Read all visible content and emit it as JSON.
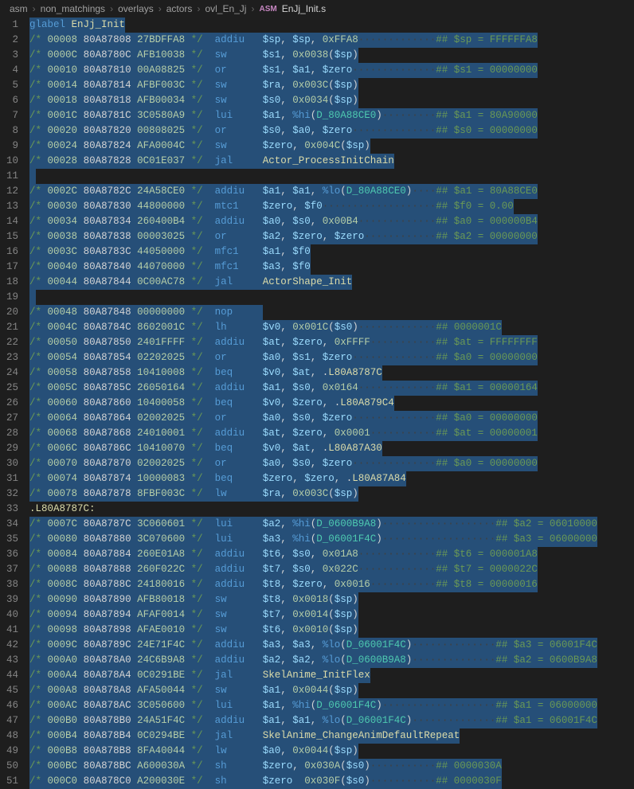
{
  "breadcrumb": {
    "parts": [
      "asm",
      "non_matchings",
      "overlays",
      "actors",
      "ovl_En_Jj"
    ],
    "file_icon_name": "asm-icon",
    "file_prefix": "ASM",
    "file": "EnJj_Init.s"
  },
  "glabel_kw": "glabel",
  "glabel_name": "EnJj_Init",
  "local_label": ".L80A8787C:",
  "lines": [
    {
      "n": 1,
      "type": "glabel"
    },
    {
      "n": 2,
      "c": "/* 00008 80A87808 27BDFFA8 */",
      "op": "addiu",
      "args": "$sp, $sp, 0xFFA8",
      "cm": "## $sp = FFFFFFA8"
    },
    {
      "n": 3,
      "c": "/* 0000C 80A8780C AFB10038 */",
      "op": "sw",
      "args": "$s1, 0x0038($sp)"
    },
    {
      "n": 4,
      "c": "/* 00010 80A87810 00A08825 */",
      "op": "or",
      "args": "$s1, $a1, $zero",
      "cm": "## $s1 = 00000000"
    },
    {
      "n": 5,
      "c": "/* 00014 80A87814 AFBF003C */",
      "op": "sw",
      "args": "$ra, 0x003C($sp)"
    },
    {
      "n": 6,
      "c": "/* 00018 80A87818 AFB00034 */",
      "op": "sw",
      "args": "$s0, 0x0034($sp)"
    },
    {
      "n": 7,
      "c": "/* 0001C 80A8781C 3C0580A9 */",
      "op": "lui",
      "args": "$a1, %hi(D_80A88CE0)",
      "cm": "## $a1 = 80A90000"
    },
    {
      "n": 8,
      "c": "/* 00020 80A87820 00808025 */",
      "op": "or",
      "args": "$s0, $a0, $zero",
      "cm": "## $s0 = 00000000"
    },
    {
      "n": 9,
      "c": "/* 00024 80A87824 AFA0004C */",
      "op": "sw",
      "args": "$zero, 0x004C($sp)"
    },
    {
      "n": 10,
      "c": "/* 00028 80A87828 0C01E037 */",
      "op": "jal",
      "args": "Actor_ProcessInitChain",
      "func": true
    },
    {
      "n": 11,
      "type": "blank"
    },
    {
      "n": 12,
      "c": "/* 0002C 80A8782C 24A58CE0 */",
      "op": "addiu",
      "args": "$a1, $a1, %lo(D_80A88CE0)",
      "cm": "## $a1 = 80A88CE0"
    },
    {
      "n": 13,
      "c": "/* 00030 80A87830 44800000 */",
      "op": "mtc1",
      "args": "$zero, $f0",
      "cm": "## $f0 = 0.00"
    },
    {
      "n": 14,
      "c": "/* 00034 80A87834 260400B4 */",
      "op": "addiu",
      "args": "$a0, $s0, 0x00B4",
      "cm": "## $a0 = 000000B4"
    },
    {
      "n": 15,
      "c": "/* 00038 80A87838 00003025 */",
      "op": "or",
      "args": "$a2, $zero, $zero",
      "cm": "## $a2 = 00000000"
    },
    {
      "n": 16,
      "c": "/* 0003C 80A8783C 44050000 */",
      "op": "mfc1",
      "args": "$a1, $f0"
    },
    {
      "n": 17,
      "c": "/* 00040 80A87840 44070000 */",
      "op": "mfc1",
      "args": "$a3, $f0"
    },
    {
      "n": 18,
      "c": "/* 00044 80A87844 0C00AC78 */",
      "op": "jal",
      "args": "ActorShape_Init",
      "func": true
    },
    {
      "n": 19,
      "type": "blank"
    },
    {
      "n": 20,
      "c": "/* 00048 80A87848 00000000 */",
      "op": "nop",
      "args": ""
    },
    {
      "n": 21,
      "c": "/* 0004C 80A8784C 8602001C */",
      "op": "lh",
      "args": "$v0, 0x001C($s0)",
      "cm": "## 0000001C"
    },
    {
      "n": 22,
      "c": "/* 00050 80A87850 2401FFFF */",
      "op": "addiu",
      "args": "$at, $zero, 0xFFFF",
      "cm": "## $at = FFFFFFFF"
    },
    {
      "n": 23,
      "c": "/* 00054 80A87854 02202025 */",
      "op": "or",
      "args": "$a0, $s1, $zero",
      "cm": "## $a0 = 00000000"
    },
    {
      "n": 24,
      "c": "/* 00058 80A87858 10410008 */",
      "op": "beq",
      "args": "$v0, $at, .L80A8787C"
    },
    {
      "n": 25,
      "c": "/* 0005C 80A8785C 26050164 */",
      "op": "addiu",
      "args": "$a1, $s0, 0x0164",
      "cm": "## $a1 = 00000164"
    },
    {
      "n": 26,
      "c": "/* 00060 80A87860 10400058 */",
      "op": "beq",
      "args": "$v0, $zero, .L80A879C4"
    },
    {
      "n": 27,
      "c": "/* 00064 80A87864 02002025 */",
      "op": "or",
      "args": "$a0, $s0, $zero",
      "cm": "## $a0 = 00000000"
    },
    {
      "n": 28,
      "c": "/* 00068 80A87868 24010001 */",
      "op": "addiu",
      "args": "$at, $zero, 0x0001",
      "cm": "## $at = 00000001"
    },
    {
      "n": 29,
      "c": "/* 0006C 80A8786C 10410070 */",
      "op": "beq",
      "args": "$v0, $at, .L80A87A30"
    },
    {
      "n": 30,
      "c": "/* 00070 80A87870 02002025 */",
      "op": "or",
      "args": "$a0, $s0, $zero",
      "cm": "## $a0 = 00000000"
    },
    {
      "n": 31,
      "c": "/* 00074 80A87874 10000083 */",
      "op": "beq",
      "args": "$zero, $zero, .L80A87A84"
    },
    {
      "n": 32,
      "c": "/* 00078 80A87878 8FBF003C */",
      "op": "lw",
      "args": "$ra, 0x003C($sp)"
    },
    {
      "n": 33,
      "type": "label"
    },
    {
      "n": 34,
      "c": "/* 0007C 80A8787C 3C060601 */",
      "op": "lui",
      "args": "$a2, %hi(D_0600B9A8)",
      "cm": "## $a2 = 06010000",
      "wide": true
    },
    {
      "n": 35,
      "c": "/* 00080 80A87880 3C070600 */",
      "op": "lui",
      "args": "$a3, %hi(D_06001F4C)",
      "cm": "## $a3 = 06000000",
      "wide": true
    },
    {
      "n": 36,
      "c": "/* 00084 80A87884 260E01A8 */",
      "op": "addiu",
      "args": "$t6, $s0, 0x01A8",
      "cm": "## $t6 = 000001A8"
    },
    {
      "n": 37,
      "c": "/* 00088 80A87888 260F022C */",
      "op": "addiu",
      "args": "$t7, $s0, 0x022C",
      "cm": "## $t7 = 0000022C"
    },
    {
      "n": 38,
      "c": "/* 0008C 80A8788C 24180016 */",
      "op": "addiu",
      "args": "$t8, $zero, 0x0016",
      "cm": "## $t8 = 00000016"
    },
    {
      "n": 39,
      "c": "/* 00090 80A87890 AFB80018 */",
      "op": "sw",
      "args": "$t8, 0x0018($sp)"
    },
    {
      "n": 40,
      "c": "/* 00094 80A87894 AFAF0014 */",
      "op": "sw",
      "args": "$t7, 0x0014($sp)"
    },
    {
      "n": 41,
      "c": "/* 00098 80A87898 AFAE0010 */",
      "op": "sw",
      "args": "$t6, 0x0010($sp)"
    },
    {
      "n": 42,
      "c": "/* 0009C 80A8789C 24E71F4C */",
      "op": "addiu",
      "args": "$a3, $a3, %lo(D_06001F4C)",
      "cm": "## $a3 = 06001F4C",
      "wide": true
    },
    {
      "n": 43,
      "c": "/* 000A0 80A878A0 24C6B9A8 */",
      "op": "addiu",
      "args": "$a2, $a2, %lo(D_0600B9A8)",
      "cm": "## $a2 = 0600B9A8",
      "wide": true
    },
    {
      "n": 44,
      "c": "/* 000A4 80A878A4 0C0291BE */",
      "op": "jal",
      "args": "SkelAnime_InitFlex",
      "func": true
    },
    {
      "n": 45,
      "c": "/* 000A8 80A878A8 AFA50044 */",
      "op": "sw",
      "args": "$a1, 0x0044($sp)"
    },
    {
      "n": 46,
      "c": "/* 000AC 80A878AC 3C050600 */",
      "op": "lui",
      "args": "$a1, %hi(D_06001F4C)",
      "cm": "## $a1 = 06000000",
      "wide": true
    },
    {
      "n": 47,
      "c": "/* 000B0 80A878B0 24A51F4C */",
      "op": "addiu",
      "args": "$a1, $a1, %lo(D_06001F4C)",
      "cm": "## $a1 = 06001F4C",
      "wide": true
    },
    {
      "n": 48,
      "c": "/* 000B4 80A878B4 0C0294BE */",
      "op": "jal",
      "args": "SkelAnime_ChangeAnimDefaultRepeat",
      "func": true
    },
    {
      "n": 49,
      "c": "/* 000B8 80A878B8 8FA40044 */",
      "op": "lw",
      "args": "$a0, 0x0044($sp)"
    },
    {
      "n": 50,
      "c": "/* 000BC 80A878BC A600030A */",
      "op": "sh",
      "args": "$zero, 0x030A($s0)",
      "cm": "## 0000030A"
    },
    {
      "n": 51,
      "c": "/* 000C0 80A878C0 A200030E */",
      "op": "sh",
      "args": "$zero  0x030F($s0)",
      "cm": "## 0000030F"
    }
  ]
}
